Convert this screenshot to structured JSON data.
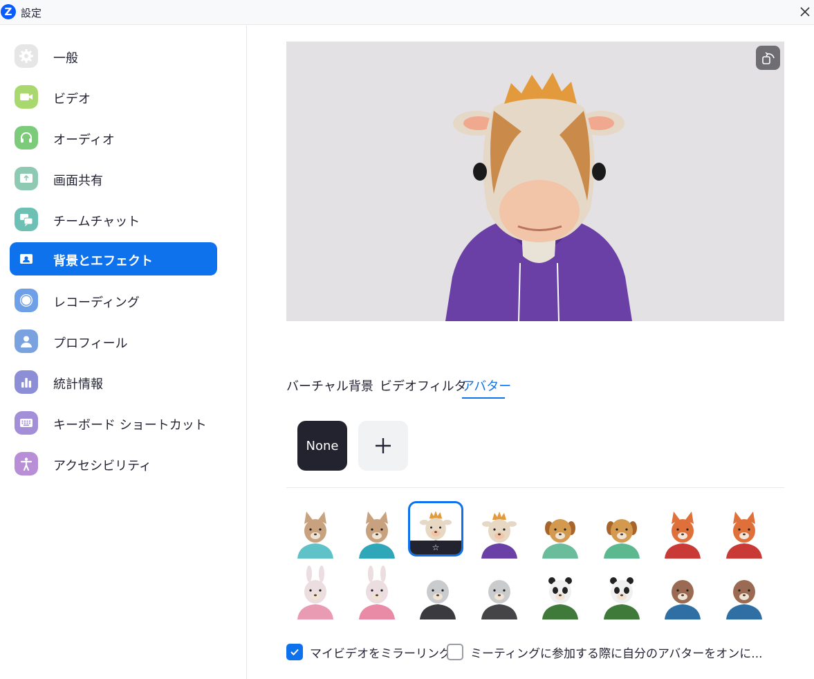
{
  "window": {
    "title": "設定",
    "logo_letter": "Z"
  },
  "sidebar": {
    "items": [
      {
        "label": "一般",
        "icon": "gear-icon",
        "color": "#e6e6e6"
      },
      {
        "label": "ビデオ",
        "icon": "video-camera-icon",
        "color": "#a9d86e"
      },
      {
        "label": "オーディオ",
        "icon": "headphones-icon",
        "color": "#7ccb7a"
      },
      {
        "label": "画面共有",
        "icon": "screen-share-icon",
        "color": "#8ec9b4"
      },
      {
        "label": "チームチャット",
        "icon": "chat-bubbles-icon",
        "color": "#6cc0b4"
      },
      {
        "label": "背景とエフェクト",
        "icon": "background-portrait-icon",
        "color": "#0e72ed"
      },
      {
        "label": "レコーディング",
        "icon": "record-circle-icon",
        "color": "#6f9fe6"
      },
      {
        "label": "プロフィール",
        "icon": "user-profile-icon",
        "color": "#7aa2e0"
      },
      {
        "label": "統計情報",
        "icon": "bar-chart-icon",
        "color": "#8c8fd6"
      },
      {
        "label": "キーボード ショートカット",
        "icon": "keyboard-icon",
        "color": "#a28fd8"
      },
      {
        "label": "アクセシビリティ",
        "icon": "accessibility-icon",
        "color": "#b88fd6"
      }
    ],
    "active_index": 5
  },
  "preview": {
    "rotate_icon": "rotate-camera-icon"
  },
  "tabs": [
    {
      "label": "バーチャル背景"
    },
    {
      "label": "ビデオフィルタ"
    },
    {
      "label": "アバター"
    }
  ],
  "active_tab": 2,
  "avatar_controls": {
    "none_label": "None",
    "add_icon": "plus-icon"
  },
  "avatars": [
    {
      "animal": "cat",
      "variant": 1,
      "head": "#c8a27f",
      "shirt": "#5fc2c9"
    },
    {
      "animal": "cat",
      "variant": 2,
      "head": "#c8a27f",
      "shirt": "#2fa7b8"
    },
    {
      "animal": "cow",
      "variant": 1,
      "head": "#e7d8c4",
      "shirt": "#23232f",
      "selected": true,
      "favorite_icon": "star-outline-icon"
    },
    {
      "animal": "cow",
      "variant": 2,
      "head": "#e7d8c4",
      "shirt": "#6a3fa6"
    },
    {
      "animal": "dog",
      "variant": 1,
      "head": "#d39a4f",
      "shirt": "#6bbc9b"
    },
    {
      "animal": "dog",
      "variant": 2,
      "head": "#d39a4f",
      "shirt": "#5cb88e"
    },
    {
      "animal": "fox",
      "variant": 1,
      "head": "#e0703a",
      "shirt": "#c93a36"
    },
    {
      "animal": "fox",
      "variant": 2,
      "head": "#e0703a",
      "shirt": "#c93a36"
    },
    {
      "animal": "rabbit",
      "variant": 1,
      "head": "#ecdde0",
      "shirt": "#e99bb3"
    },
    {
      "animal": "rabbit",
      "variant": 2,
      "head": "#ecdde0",
      "shirt": "#e98aa6"
    },
    {
      "animal": "seal",
      "variant": 1,
      "head": "#c9cbcd",
      "shirt": "#3b3b3f"
    },
    {
      "animal": "seal",
      "variant": 2,
      "head": "#c9cbcd",
      "shirt": "#454548"
    },
    {
      "animal": "panda",
      "variant": 1,
      "head": "#f0f0f0",
      "shirt": "#3f7a3a"
    },
    {
      "animal": "panda",
      "variant": 2,
      "head": "#f0f0f0",
      "shirt": "#3f7a3a"
    },
    {
      "animal": "otter",
      "variant": 1,
      "head": "#9a6a52",
      "shirt": "#2f6fa3"
    },
    {
      "animal": "otter",
      "variant": 2,
      "head": "#9a6a52",
      "shirt": "#2f6fa3"
    }
  ],
  "options": {
    "mirror": {
      "label": "マイビデオをミラーリング",
      "checked": true
    },
    "avatar_on_join": {
      "label": "ミーティングに参加する際に自分のアバターをオンに...",
      "checked": false
    }
  },
  "colors": {
    "accent": "#0e72ed",
    "dark": "#23232f"
  }
}
